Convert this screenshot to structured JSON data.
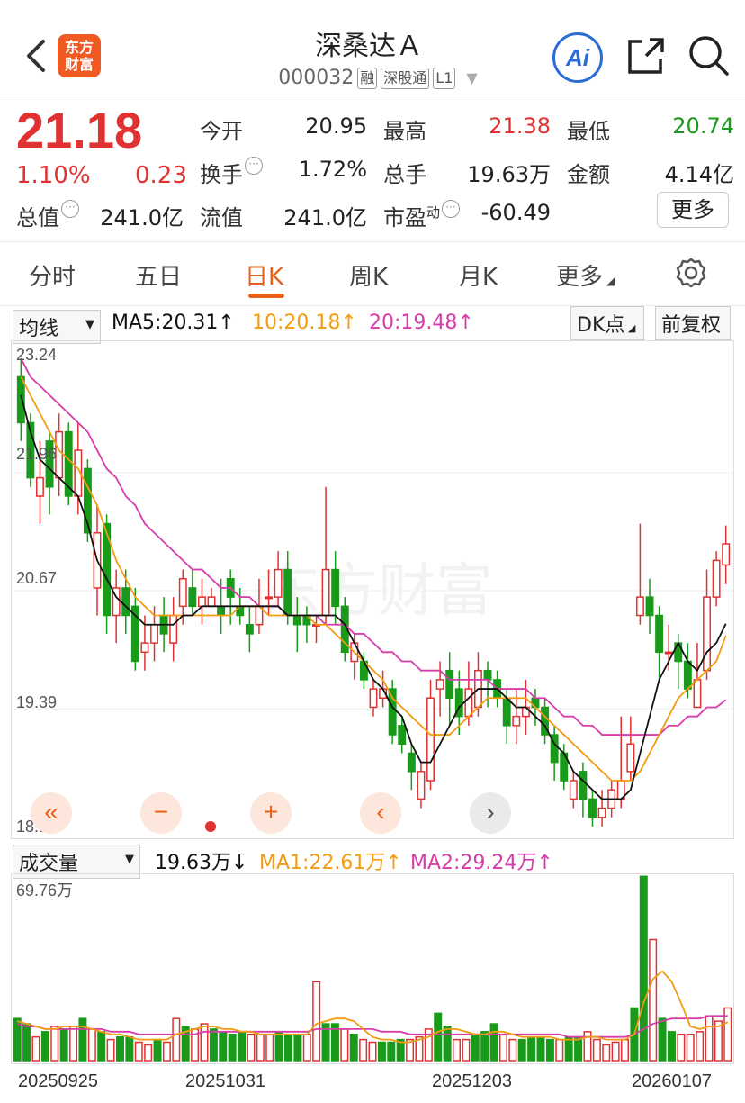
{
  "header": {
    "title": "深桑达Ａ",
    "code": "000032",
    "tags": [
      "融",
      "深股通",
      "L1"
    ],
    "logo_lines": [
      "东方",
      "财富"
    ],
    "ai_label": "Ai",
    "icons": [
      "back-icon",
      "share-icon",
      "search-icon"
    ]
  },
  "quote": {
    "price": "21.18",
    "change_pct": "1.10%",
    "change": "0.23",
    "rows": [
      [
        {
          "label": "今开",
          "value": "20.95"
        },
        {
          "label": "最高",
          "value": "21.38"
        },
        {
          "label": "最低",
          "value": "20.74"
        }
      ],
      [
        {
          "label": "换手",
          "value": "1.72%"
        },
        {
          "label": "总手",
          "value": "19.63万"
        },
        {
          "label": "金额",
          "value": "4.14亿"
        }
      ],
      [
        {
          "label": "总值",
          "value": "241.0亿"
        },
        {
          "label": "流值",
          "value": "241.0亿"
        },
        {
          "label": "市盈",
          "sup": "动",
          "value": "-60.49"
        }
      ]
    ],
    "more_button": "更多"
  },
  "tabs": [
    "分时",
    "五日",
    "日K",
    "周K",
    "月K",
    "更多"
  ],
  "active_tab": "日K",
  "chart_controls": {
    "indicator_select": "均线",
    "ma5": "MA5:20.31↑",
    "ma10": "10:20.18↑",
    "ma20": "20:19.48↑",
    "dk_button": "DK点",
    "adjust_button": "前复权"
  },
  "volume_controls": {
    "select": "成交量",
    "vol": "19.63万↓",
    "ma1": "MA1:22.61万↑",
    "ma2": "MA2:29.24万↑"
  },
  "watermark": "东方财富",
  "colors": {
    "up": "#e03232",
    "down": "#1a9a1a",
    "ma5": "#111111",
    "ma10": "#f39c12",
    "ma20": "#d63caa",
    "accent": "#e8611a"
  },
  "chart_data": [
    {
      "type": "candlestick",
      "y_ticks": [
        "23.24",
        "21.96",
        "20.67",
        "19.39",
        "18.10"
      ],
      "ylim": [
        18.1,
        23.24
      ],
      "x_labels": [
        "20250925",
        "20251031",
        "20251203",
        "20260107"
      ],
      "candles": [
        [
          23.0,
          22.5,
          23.2,
          22.3
        ],
        [
          22.5,
          21.9,
          22.6,
          21.8
        ],
        [
          21.7,
          21.9,
          22.3,
          21.4
        ],
        [
          22.3,
          21.8,
          22.4,
          21.5
        ],
        [
          21.9,
          22.4,
          22.6,
          21.7
        ],
        [
          22.4,
          21.7,
          22.5,
          21.6
        ],
        [
          21.7,
          22.2,
          22.5,
          21.5
        ],
        [
          22.0,
          21.3,
          22.1,
          21.2
        ],
        [
          20.7,
          21.3,
          21.6,
          20.4
        ],
        [
          21.4,
          20.4,
          21.5,
          20.2
        ],
        [
          20.4,
          20.7,
          20.9,
          20.1
        ],
        [
          20.7,
          20.4,
          20.9,
          20.2
        ],
        [
          20.5,
          19.9,
          20.7,
          19.8
        ],
        [
          20.0,
          20.1,
          20.4,
          19.8
        ],
        [
          20.1,
          20.3,
          20.5,
          19.9
        ],
        [
          20.4,
          20.2,
          20.6,
          20.0
        ],
        [
          20.1,
          20.4,
          20.6,
          19.9
        ],
        [
          20.5,
          20.8,
          20.9,
          20.3
        ],
        [
          20.7,
          20.5,
          20.9,
          20.4
        ],
        [
          20.5,
          20.6,
          20.8,
          20.3
        ],
        [
          20.5,
          20.6,
          20.7,
          20.5
        ],
        [
          20.5,
          20.4,
          20.8,
          20.2
        ],
        [
          20.8,
          20.6,
          20.9,
          20.3
        ],
        [
          20.5,
          20.4,
          20.7,
          20.3
        ],
        [
          20.3,
          20.2,
          20.5,
          20.0
        ],
        [
          20.3,
          20.5,
          20.8,
          20.2
        ],
        [
          20.6,
          20.6,
          20.9,
          20.4
        ],
        [
          20.6,
          20.9,
          21.1,
          20.5
        ],
        [
          20.9,
          20.4,
          21.1,
          20.3
        ],
        [
          20.4,
          20.3,
          20.6,
          20.0
        ],
        [
          20.4,
          20.3,
          20.5,
          20.1
        ],
        [
          20.3,
          20.3,
          20.4,
          20.1
        ],
        [
          20.4,
          20.9,
          21.8,
          20.3
        ],
        [
          20.9,
          20.5,
          21.1,
          20.3
        ],
        [
          20.5,
          20.0,
          20.6,
          19.9
        ],
        [
          19.9,
          20.1,
          20.2,
          19.7
        ],
        [
          19.9,
          19.7,
          20.0,
          19.6
        ],
        [
          19.4,
          19.6,
          19.7,
          19.3
        ],
        [
          19.5,
          19.6,
          19.8,
          19.4
        ],
        [
          19.6,
          19.1,
          19.7,
          19.0
        ],
        [
          19.2,
          19.0,
          19.3,
          18.9
        ],
        [
          18.9,
          18.7,
          19.0,
          18.5
        ],
        [
          18.4,
          18.7,
          18.8,
          18.3
        ],
        [
          18.6,
          19.5,
          19.7,
          18.5
        ],
        [
          19.6,
          19.7,
          19.9,
          19.3
        ],
        [
          19.8,
          19.5,
          20.0,
          19.2
        ],
        [
          19.6,
          19.3,
          19.8,
          19.1
        ],
        [
          19.3,
          19.6,
          19.9,
          19.2
        ],
        [
          19.4,
          19.8,
          20.0,
          19.3
        ],
        [
          19.8,
          19.7,
          19.9,
          19.4
        ],
        [
          19.7,
          19.5,
          19.8,
          19.4
        ],
        [
          19.5,
          19.2,
          19.6,
          19.0
        ],
        [
          19.2,
          19.3,
          19.6,
          19.0
        ],
        [
          19.3,
          19.4,
          19.7,
          19.1
        ],
        [
          19.5,
          19.4,
          19.6,
          19.2
        ],
        [
          19.4,
          19.1,
          19.5,
          19.0
        ],
        [
          19.1,
          18.8,
          19.2,
          18.6
        ],
        [
          18.9,
          18.6,
          19.0,
          18.5
        ],
        [
          18.4,
          18.6,
          18.7,
          18.3
        ],
        [
          18.7,
          18.4,
          18.8,
          18.2
        ],
        [
          18.4,
          18.2,
          18.5,
          18.1
        ],
        [
          18.2,
          18.3,
          18.5,
          18.1
        ],
        [
          18.3,
          18.5,
          18.6,
          18.2
        ],
        [
          18.4,
          18.6,
          19.3,
          18.3
        ],
        [
          18.7,
          19.0,
          19.3,
          18.6
        ],
        [
          20.4,
          20.6,
          21.4,
          20.3
        ],
        [
          20.6,
          20.4,
          20.8,
          20.2
        ],
        [
          20.4,
          20.0,
          20.5,
          19.7
        ],
        [
          20.0,
          20.0,
          20.3,
          19.8
        ],
        [
          20.1,
          19.9,
          20.2,
          19.6
        ],
        [
          19.9,
          19.6,
          20.1,
          19.5
        ],
        [
          19.4,
          19.7,
          20.1,
          19.4
        ],
        [
          19.8,
          20.6,
          20.9,
          19.7
        ],
        [
          20.6,
          21.0,
          21.1,
          20.5
        ],
        [
          20.95,
          21.18,
          21.38,
          20.74
        ]
      ],
      "series_ma5": [
        22.8,
        22.4,
        22.1,
        22.0,
        21.9,
        21.8,
        21.7,
        21.4,
        21.0,
        20.8,
        20.6,
        20.5,
        20.4,
        20.3,
        20.3,
        20.3,
        20.3,
        20.4,
        20.4,
        20.5,
        20.5,
        20.5,
        20.5,
        20.5,
        20.5,
        20.5,
        20.5,
        20.5,
        20.4,
        20.4,
        20.4,
        20.4,
        20.4,
        20.4,
        20.3,
        20.1,
        19.9,
        19.7,
        19.6,
        19.4,
        19.3,
        19.0,
        18.8,
        18.8,
        19.0,
        19.2,
        19.4,
        19.5,
        19.6,
        19.6,
        19.6,
        19.5,
        19.4,
        19.4,
        19.3,
        19.2,
        19.0,
        18.9,
        18.7,
        18.6,
        18.5,
        18.4,
        18.4,
        18.4,
        18.5,
        18.9,
        19.3,
        19.7,
        19.9,
        20.1,
        19.9,
        19.8,
        20.0,
        20.1,
        20.31
      ],
      "series_ma10": [
        23.0,
        22.8,
        22.6,
        22.4,
        22.2,
        22.1,
        22.0,
        21.8,
        21.6,
        21.3,
        21.0,
        20.8,
        20.6,
        20.5,
        20.4,
        20.4,
        20.4,
        20.4,
        20.4,
        20.4,
        20.4,
        20.4,
        20.4,
        20.5,
        20.5,
        20.5,
        20.4,
        20.4,
        20.4,
        20.4,
        20.4,
        20.3,
        20.3,
        20.2,
        20.1,
        20.0,
        19.9,
        19.8,
        19.7,
        19.5,
        19.4,
        19.3,
        19.2,
        19.1,
        19.1,
        19.1,
        19.2,
        19.3,
        19.4,
        19.5,
        19.5,
        19.5,
        19.5,
        19.5,
        19.4,
        19.3,
        19.2,
        19.1,
        19.0,
        18.9,
        18.8,
        18.7,
        18.6,
        18.6,
        18.6,
        18.7,
        18.9,
        19.1,
        19.3,
        19.5,
        19.6,
        19.7,
        19.8,
        19.9,
        20.18
      ],
      "series_ma20": [
        23.2,
        23.0,
        22.9,
        22.8,
        22.7,
        22.6,
        22.5,
        22.4,
        22.2,
        22.0,
        21.9,
        21.7,
        21.6,
        21.4,
        21.3,
        21.2,
        21.1,
        21.0,
        20.9,
        20.9,
        20.8,
        20.7,
        20.7,
        20.6,
        20.6,
        20.5,
        20.5,
        20.5,
        20.4,
        20.4,
        20.4,
        20.4,
        20.3,
        20.3,
        20.3,
        20.2,
        20.2,
        20.1,
        20.0,
        20.0,
        19.9,
        19.9,
        19.8,
        19.8,
        19.8,
        19.7,
        19.7,
        19.7,
        19.7,
        19.7,
        19.6,
        19.6,
        19.6,
        19.6,
        19.5,
        19.5,
        19.4,
        19.3,
        19.3,
        19.2,
        19.2,
        19.1,
        19.1,
        19.1,
        19.1,
        19.1,
        19.1,
        19.1,
        19.2,
        19.2,
        19.3,
        19.3,
        19.4,
        19.4,
        19.48
      ]
    },
    {
      "type": "bar",
      "ymax_label": "69.76万",
      "ymax": 69.76,
      "volumes": [
        16,
        14,
        9,
        11,
        13,
        12,
        13,
        16,
        12,
        11,
        8,
        9,
        9,
        7,
        6,
        8,
        7,
        16,
        13,
        12,
        14,
        12,
        11,
        10,
        11,
        10,
        10,
        10,
        11,
        10,
        10,
        10,
        30,
        14,
        14,
        12,
        10,
        8,
        7,
        7,
        7,
        8,
        8,
        9,
        12,
        18,
        13,
        8,
        8,
        10,
        11,
        14,
        10,
        8,
        8,
        9,
        9,
        8,
        8,
        9,
        9,
        11,
        8,
        6,
        7,
        8,
        20,
        70,
        46,
        16,
        11,
        10,
        10,
        11,
        17,
        15,
        20
      ],
      "ma1": [
        15,
        14,
        13,
        12,
        12,
        13,
        13,
        13,
        12,
        11,
        10,
        10,
        9,
        8,
        8,
        8,
        8,
        10,
        11,
        12,
        13,
        13,
        12,
        12,
        11,
        11,
        10,
        10,
        10,
        10,
        10,
        10,
        14,
        15,
        16,
        16,
        15,
        12,
        9,
        8,
        8,
        7,
        7,
        8,
        9,
        11,
        12,
        12,
        11,
        10,
        10,
        11,
        11,
        10,
        9,
        9,
        9,
        9,
        8,
        8,
        8,
        9,
        9,
        8,
        8,
        8,
        10,
        22,
        31,
        34,
        30,
        22,
        13,
        12,
        13,
        13,
        14.6
      ],
      "ma2": [
        14,
        13,
        13,
        12,
        12,
        12,
        12,
        12,
        12,
        12,
        11,
        11,
        11,
        10,
        10,
        10,
        10,
        10,
        10,
        10,
        11,
        11,
        11,
        11,
        11,
        11,
        11,
        11,
        11,
        11,
        11,
        11,
        12,
        12,
        12,
        12,
        12,
        12,
        12,
        11,
        11,
        11,
        10,
        10,
        10,
        10,
        10,
        10,
        10,
        10,
        10,
        10,
        10,
        10,
        10,
        10,
        10,
        10,
        10,
        9,
        9,
        9,
        9,
        9,
        9,
        9,
        10,
        12,
        14,
        15,
        16,
        16,
        16,
        16,
        17,
        17,
        17
      ]
    }
  ],
  "nav_buttons": [
    "«",
    "−",
    "+",
    "‹",
    "›"
  ]
}
